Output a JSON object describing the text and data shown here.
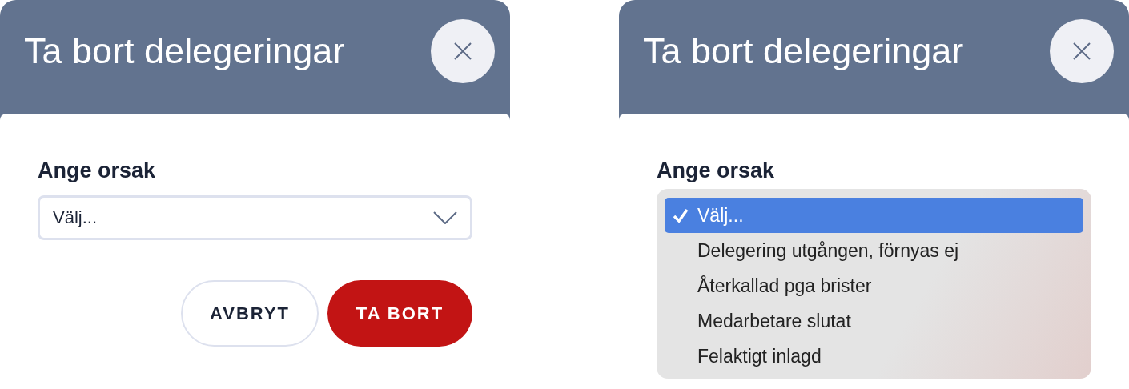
{
  "dialogs": [
    {
      "kind": "closed",
      "title": "Ta bort delegeringar",
      "field_label": "Ange orsak",
      "select": {
        "value": "Välj..."
      },
      "buttons": [
        {
          "label": "AVBRYT",
          "kind": "secondary"
        },
        {
          "label": "TA BORT",
          "kind": "danger"
        }
      ]
    },
    {
      "kind": "open",
      "title": "Ta bort delegeringar",
      "field_label": "Ange orsak",
      "options": [
        {
          "label": "Välj...",
          "selected": true
        },
        {
          "label": "Delegering utgången, förnyas ej",
          "selected": false
        },
        {
          "label": "Återkallad pga brister",
          "selected": false
        },
        {
          "label": "Medarbetare slutat",
          "selected": false
        },
        {
          "label": "Felaktigt inlagd",
          "selected": false
        }
      ]
    }
  ]
}
